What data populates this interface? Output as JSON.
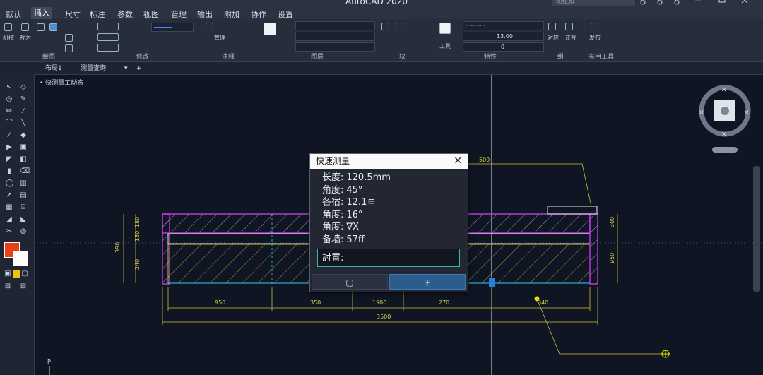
{
  "app": {
    "title": "AutoCAD 2020",
    "search_placeholder": "图纸框"
  },
  "menu": {
    "tabs": [
      "默认",
      "插入",
      "尺寸",
      "标注",
      "参数",
      "视图",
      "管理",
      "输出",
      "附加",
      "协作",
      "设置"
    ],
    "active_index": 1
  },
  "ribbon": {
    "panels": [
      "绘图",
      "修改",
      "注释",
      "图层",
      "块",
      "特性",
      "组",
      "实用工具"
    ],
    "layer_field": "0",
    "lineweight_field": "13.00",
    "color_field": "0",
    "buttons": [
      "机械",
      "视为",
      "管理",
      "工具",
      "对应",
      "正视",
      "发布"
    ]
  },
  "doc_tabs": [
    {
      "label": "布局1"
    },
    {
      "label": "测量查询"
    }
  ],
  "panel_title": "• 快测量工动态",
  "dialog": {
    "title": "快速测量",
    "rows": [
      {
        "k": "长度:",
        "v": "120.5mm"
      },
      {
        "k": "角度:",
        "v": "45°"
      },
      {
        "k": "各宿:",
        "v": "12.1ㅌ"
      },
      {
        "k": "角度:",
        "v": "16°"
      },
      {
        "k": "角度:",
        "v": "∇X"
      },
      {
        "k": "备墙:",
        "v": "57ff"
      }
    ],
    "input_label": "討置:",
    "btn_left": "▢",
    "btn_right": "⊞"
  },
  "drawing": {
    "dims_bottom": [
      "950",
      "350",
      "1900",
      "270",
      "340"
    ],
    "total": "3500",
    "top_dim": "500",
    "left_dims": [
      "390",
      "150",
      "180",
      "240"
    ],
    "right_dims": [
      "300",
      "950"
    ],
    "ucs": "P"
  },
  "colors": {
    "accent": "#3e79b4",
    "magenta": "#b43bd8",
    "cyan": "#37c9ff",
    "yellow": "#d8d24a",
    "white": "#e6e6e6"
  }
}
